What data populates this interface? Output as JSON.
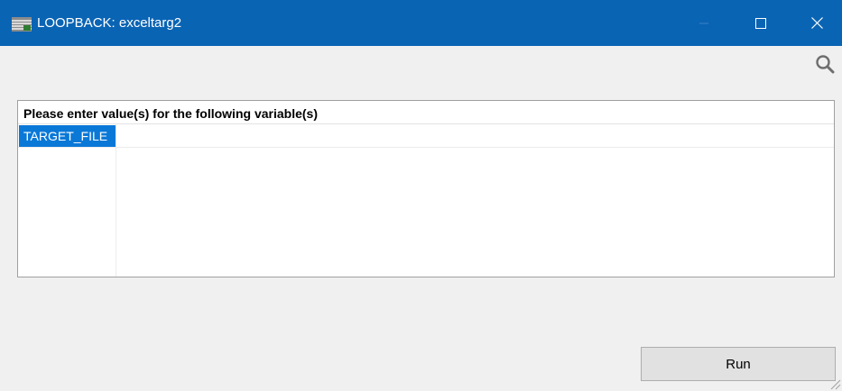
{
  "window": {
    "title": "LOOPBACK: exceltarg2",
    "app_icon": "table-icon",
    "controls": {
      "minimize_icon": "minimize-icon",
      "maximize_icon": "maximize-icon",
      "close_icon": "close-icon"
    },
    "titlebar_color": "#0a64b4"
  },
  "toolbar": {
    "search_icon": "search-icon"
  },
  "variables_table": {
    "header": "Please enter value(s) for the following variable(s)",
    "rows": [
      {
        "name": "TARGET_FILE",
        "value": ""
      }
    ],
    "selection_color": "#0a78d7"
  },
  "actions": {
    "run_label": "Run"
  }
}
